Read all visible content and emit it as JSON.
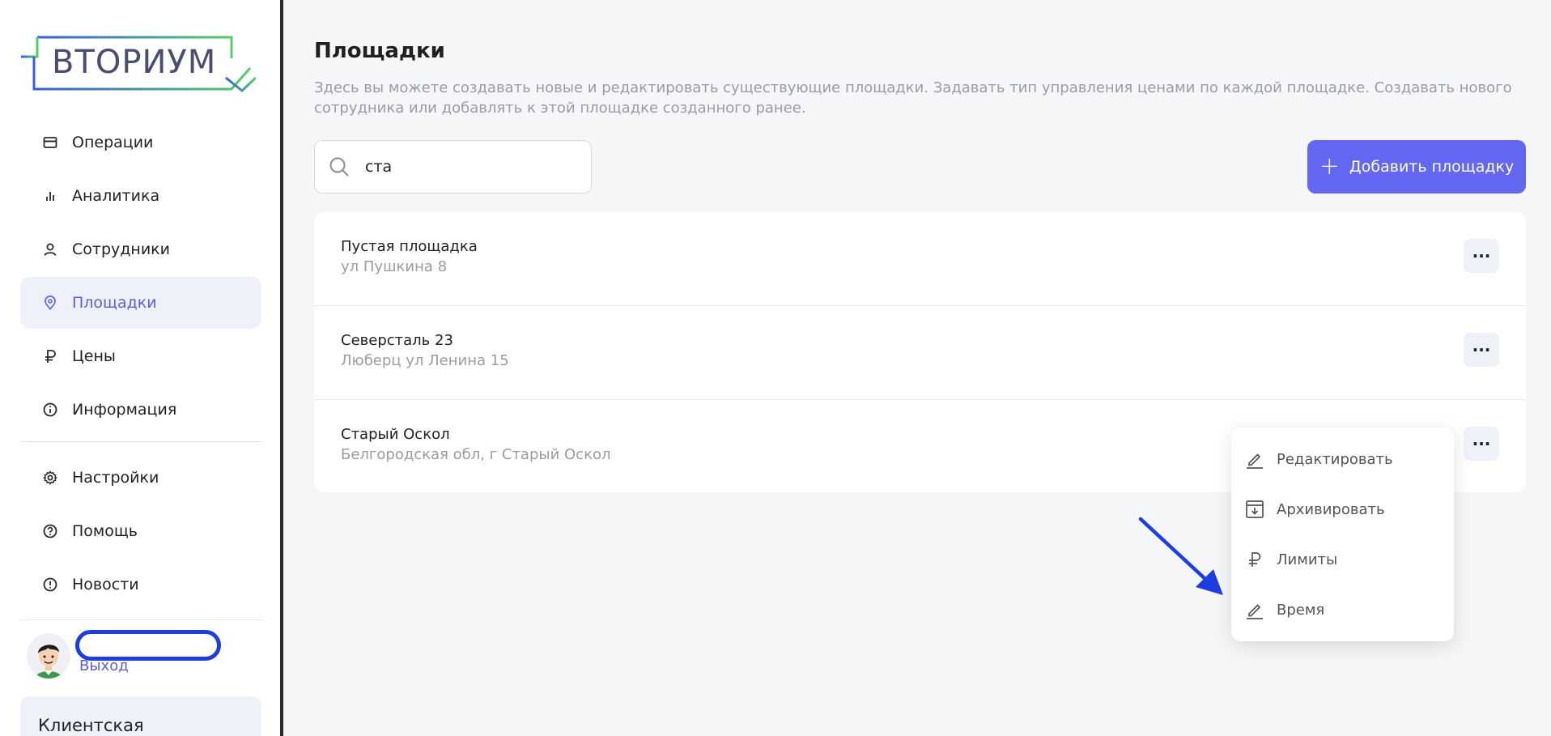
{
  "brand": {
    "logo_text": "ВТОРИУМ"
  },
  "sidebar": {
    "nav": [
      {
        "label": "Операции",
        "icon": "card-icon"
      },
      {
        "label": "Аналитика",
        "icon": "chart-icon"
      },
      {
        "label": "Сотрудники",
        "icon": "user-icon"
      },
      {
        "label": "Площадки",
        "icon": "location-icon",
        "active": true
      },
      {
        "label": "Цены",
        "icon": "ruble-icon"
      },
      {
        "label": "Информация",
        "icon": "info-icon"
      }
    ],
    "nav2": [
      {
        "label": "Настройки",
        "icon": "gear-icon"
      },
      {
        "label": "Помощь",
        "icon": "help-icon"
      },
      {
        "label": "Новости",
        "icon": "alert-icon"
      }
    ],
    "user": {
      "logout_label": "Выход"
    },
    "client_label": "Клиентская"
  },
  "main": {
    "title": "Площадки",
    "description": "Здесь вы можете создавать новые и редактировать существующие площадки. Задавать тип управления ценами по каждой площадке. Создавать нового сотрудника или добавлять к этой площадке созданного ранее.",
    "search": {
      "value": "ста"
    },
    "add_button_label": "Добавить площадку",
    "sites": [
      {
        "name": "Пустая площадка",
        "address": "ул Пушкина 8"
      },
      {
        "name": "Северсталь 23",
        "address": "Люберц ул Ленина 15"
      },
      {
        "name": "Старый Оскол",
        "address": "Белгородская обл, г Старый Оскол"
      }
    ],
    "more_label": "···"
  },
  "context_menu": {
    "items": [
      {
        "label": "Редактировать",
        "icon": "pencil-icon"
      },
      {
        "label": "Архивировать",
        "icon": "archive-icon"
      },
      {
        "label": "Лимиты",
        "icon": "ruble-icon"
      },
      {
        "label": "Время",
        "icon": "pencil-icon"
      }
    ]
  },
  "colors": {
    "accent": "#6367f1",
    "annotation_blue": "#1d3de0",
    "logo_gradient_start": "#3b5bdb",
    "logo_gradient_end": "#51cf66"
  }
}
